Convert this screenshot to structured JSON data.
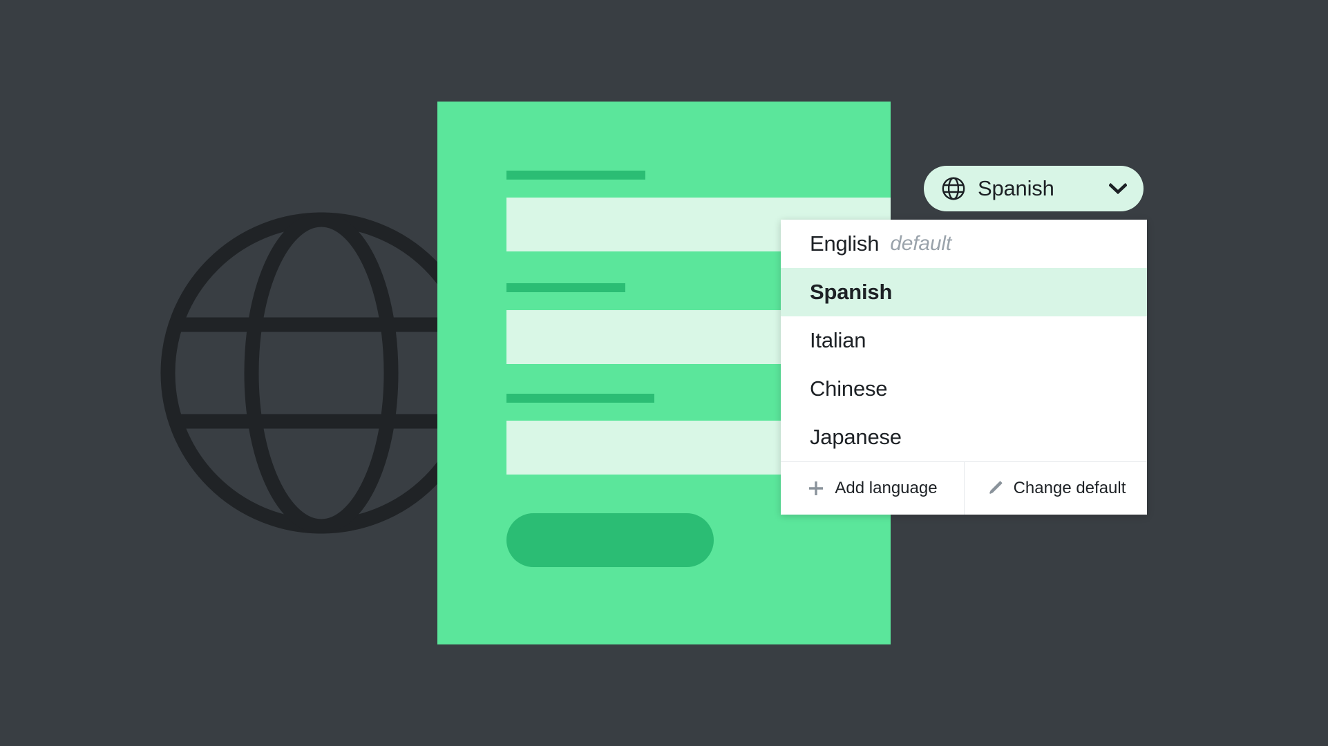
{
  "theme": {
    "background": "#393e43",
    "card_green": "#5be69b",
    "accent_green": "#2bbd74",
    "field_fill": "#d9f7e6",
    "pill_fill": "#d8f5e6",
    "menu_background": "#ffffff",
    "selected_row": "#d8f5e6",
    "text_dark": "#1d2125",
    "muted_text": "#9aa3ab",
    "globe_outline": "#202326"
  },
  "background_decor": {
    "globe_icon": "globe-icon"
  },
  "form_card": {
    "fields": [
      {
        "label_placeholder": "",
        "input_placeholder": ""
      },
      {
        "label_placeholder": "",
        "input_placeholder": ""
      },
      {
        "label_placeholder": "",
        "input_placeholder": ""
      }
    ],
    "submit_label": ""
  },
  "language_selector": {
    "globe_icon": "globe-icon",
    "selected_language": "Spanish",
    "chevron_icon": "chevron-down-icon",
    "expanded": true
  },
  "language_menu": {
    "options": [
      {
        "label": "English",
        "badge": "default",
        "selected": false
      },
      {
        "label": "Spanish",
        "badge": "",
        "selected": true
      },
      {
        "label": "Italian",
        "badge": "",
        "selected": false
      },
      {
        "label": "Chinese",
        "badge": "",
        "selected": false
      },
      {
        "label": "Japanese",
        "badge": "",
        "selected": false
      }
    ],
    "actions": [
      {
        "label": "Add language",
        "icon": "plus-icon"
      },
      {
        "label": "Change default",
        "icon": "pencil-icon"
      }
    ]
  }
}
